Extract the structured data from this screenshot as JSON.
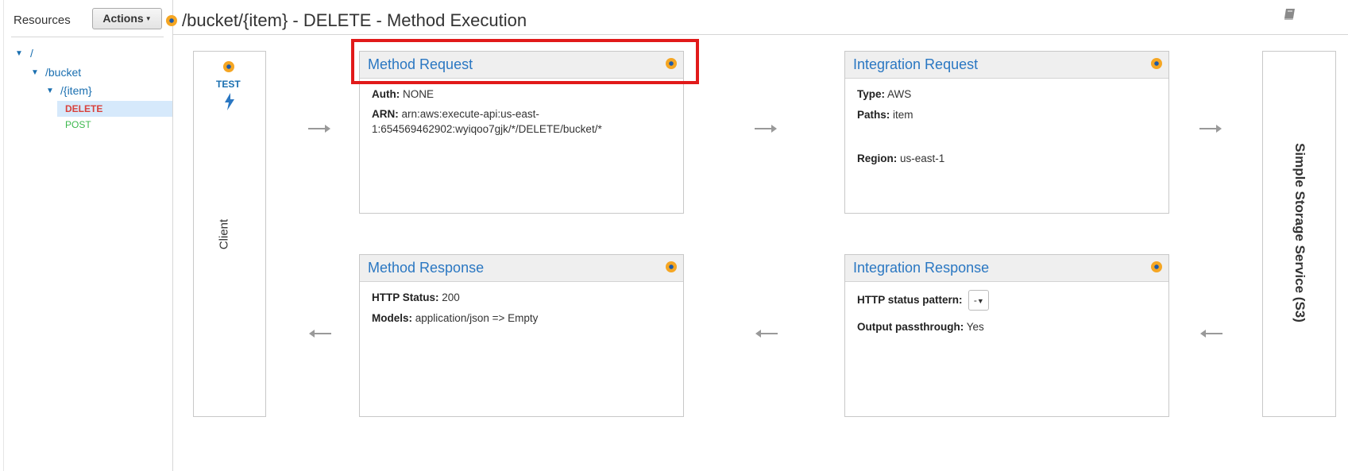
{
  "sidebar": {
    "resources_label": "Resources",
    "actions_label": "Actions",
    "tree": {
      "root": "/",
      "bucket": "/bucket",
      "item": "/{item}",
      "methods": [
        "DELETE",
        "POST"
      ]
    }
  },
  "header": {
    "title": "/bucket/{item} - DELETE - Method Execution"
  },
  "client": {
    "test_label": "TEST",
    "label": "Client"
  },
  "backend": {
    "label": "Simple Storage Service (S3)"
  },
  "method_request": {
    "title": "Method Request",
    "auth_label": "Auth:",
    "auth_value": "NONE",
    "arn_label": "ARN:",
    "arn_value_line1": "arn:aws:execute-api:us-east-",
    "arn_value_line2": "1:654569462902:wyiqoo7gjk/*/DELETE/bucket/*"
  },
  "integration_request": {
    "title": "Integration Request",
    "type_label": "Type:",
    "type_value": "AWS",
    "paths_label": "Paths:",
    "paths_value": "item",
    "region_label": "Region:",
    "region_value": "us-east-1"
  },
  "method_response": {
    "title": "Method Response",
    "status_label": "HTTP Status:",
    "status_value": "200",
    "models_label": "Models:",
    "models_value": "application/json => Empty"
  },
  "integration_response": {
    "title": "Integration Response",
    "pattern_label": "HTTP status pattern:",
    "pattern_value": "-",
    "passthrough_label": "Output passthrough:",
    "passthrough_value": "Yes"
  },
  "colors": {
    "link_blue": "#2a77c2",
    "delete_red": "#d9413b",
    "post_green": "#3cb84d",
    "highlight_red": "#e11a1a",
    "status_dot_orange": "#f5a623"
  },
  "icons": [
    "dot-status-icon",
    "bolt-icon",
    "book-icon",
    "arrow-right-icon",
    "arrow-left-icon",
    "triangle-down-icon",
    "caret-down-icon"
  ]
}
